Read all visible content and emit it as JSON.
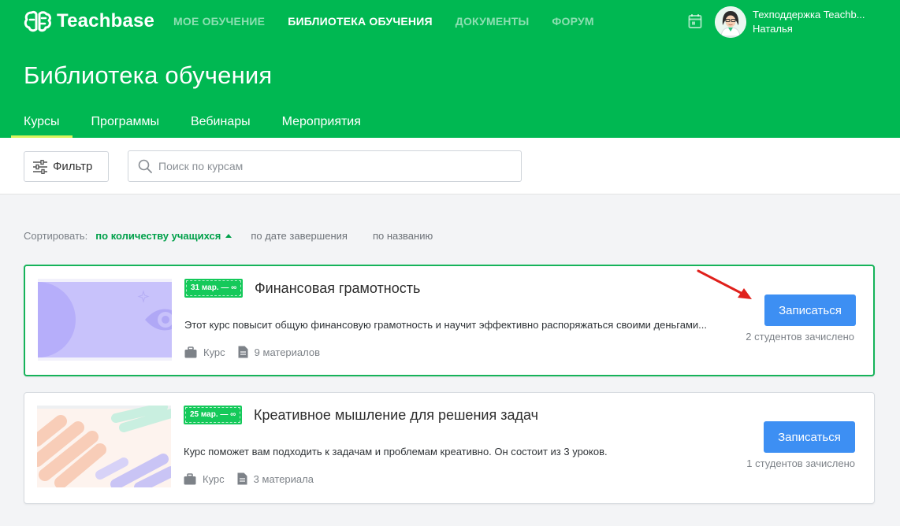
{
  "app": {
    "logo_text": "Teachbase",
    "nav": [
      {
        "label": "МОЕ ОБУЧЕНИЕ",
        "active": false
      },
      {
        "label": "БИБЛИОТЕКА ОБУЧЕНИЯ",
        "active": true
      },
      {
        "label": "ДОКУМЕНТЫ",
        "active": false
      },
      {
        "label": "ФОРУМ",
        "active": false
      }
    ],
    "user": {
      "name": "Техподдержка Teachb...",
      "subname": "Наталья"
    }
  },
  "page": {
    "title": "Библиотека обучения",
    "tabs": [
      {
        "label": "Курсы",
        "active": true
      },
      {
        "label": "Программы",
        "active": false
      },
      {
        "label": "Вебинары",
        "active": false
      },
      {
        "label": "Мероприятия",
        "active": false
      }
    ]
  },
  "toolbar": {
    "filter_label": "Фильтр",
    "search_placeholder": "Поиск по курсам"
  },
  "sort": {
    "label": "Сортировать:",
    "options": [
      {
        "label": "по количеству учащихся",
        "active": true
      },
      {
        "label": "по дате завершения",
        "active": false
      },
      {
        "label": "по названию",
        "active": false
      }
    ]
  },
  "courses": [
    {
      "date": "31 мар. — ∞",
      "title": "Финансовая грамотность",
      "description": "Этот курс повысит общую финансовую грамотность и научит эффективно распоряжаться своими деньгами...",
      "type": "Курс",
      "materials": "9 материалов",
      "enroll_label": "Записаться",
      "students": "2 студентов зачислено"
    },
    {
      "date": "25 мар. — ∞",
      "title": "Креативное мышление для решения задач",
      "description": "Курс поможет вам подходить к задачам и проблемам креативно. Он состоит из 3 уроков.",
      "type": "Курс",
      "materials": "3 материала",
      "enroll_label": "Записаться",
      "students": "1 студентов зачислено"
    }
  ],
  "colors": {
    "brand": "#00b852",
    "accent_underline": "#d8f55c",
    "button": "#3d8ff3",
    "badge": "#14c95a",
    "annotation_arrow": "#e0201b"
  }
}
